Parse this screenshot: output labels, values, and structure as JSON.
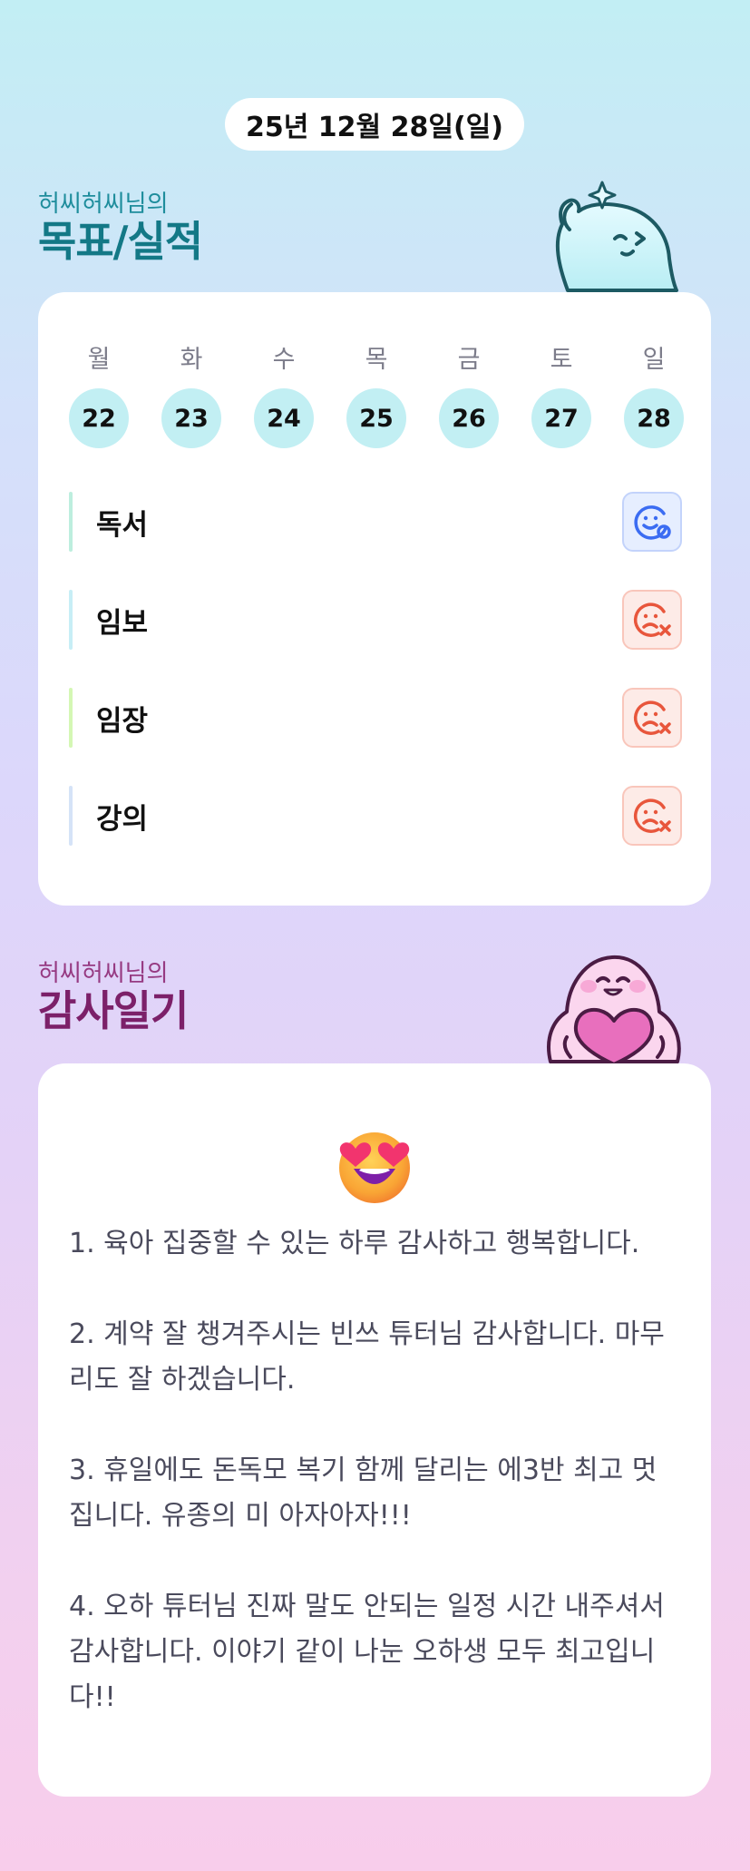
{
  "date_label": "25년 12월 28일(일)",
  "goal_section": {
    "owner": "허씨허씨님의",
    "title": "목표/실적"
  },
  "week": [
    {
      "dow": "월",
      "day": "22"
    },
    {
      "dow": "화",
      "day": "23"
    },
    {
      "dow": "수",
      "day": "24"
    },
    {
      "dow": "목",
      "day": "25"
    },
    {
      "dow": "금",
      "day": "26"
    },
    {
      "dow": "토",
      "day": "27"
    },
    {
      "dow": "일",
      "day": "28"
    }
  ],
  "goals": [
    {
      "label": "독서",
      "status": "done",
      "bar_color": "#bdeede",
      "icon": "smile-check-icon"
    },
    {
      "label": "임보",
      "status": "missed",
      "bar_color": "#c7eef6",
      "icon": "sad-x-icon"
    },
    {
      "label": "임장",
      "status": "missed",
      "bar_color": "#d4f7b4",
      "icon": "sad-x-icon"
    },
    {
      "label": "강의",
      "status": "missed",
      "bar_color": "#d5e3f7",
      "icon": "sad-x-icon"
    }
  ],
  "gratitude_section": {
    "owner": "허씨허씨님의",
    "title": "감사일기"
  },
  "gratitude": {
    "emoji": "heart-eyes-emoji",
    "entries": [
      "1. 육아 집중할 수 있는 하루 감사하고 행복합니다.",
      "2. 계약 잘 챙겨주시는 빈쓰 튜터님 감사합니다. 마무리도 잘 하겠습니다.",
      "3. 휴일에도 돈독모 복기 함께 달리는 에3반 최고 멋집니다. 유종의 미 아자아자!!!",
      "4. 오하 튜터님 진짜 말도 안되는 일정 시간 내주셔서 감사합니다. 이야기 같이 나눈 오하생 모두 최고입니다!!"
    ]
  },
  "colors": {
    "accent_teal": "#137886",
    "accent_plum": "#7c2069",
    "ok_blue": "#3b6cf2",
    "miss_red": "#e8563c"
  }
}
